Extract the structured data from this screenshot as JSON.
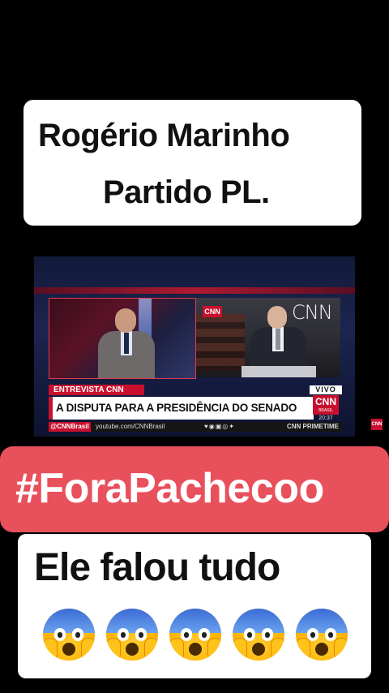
{
  "caption_top": {
    "line1": "Rogério Marinho",
    "line2": "Partido PL."
  },
  "video": {
    "wall_logo": "CNN",
    "small_logo": "CNN",
    "lower_third": {
      "tag": "ENTREVISTA CNN",
      "headline": "A DISPUTA PARA A PRESIDÊNCIA DO SENADO",
      "live": "VIVO",
      "logo": "CNN",
      "logo_sub": "BRASIL",
      "time": "20:37"
    },
    "ticker": {
      "brand": "@CNNBrasil",
      "url": "youtube.com/CNNBrasil",
      "social": "♥◉▣◎✦",
      "program": "CNN PRIMETIME"
    },
    "watermark": "CNN"
  },
  "hashtag": "#ForaPachecoo",
  "caption_bottom": {
    "text": "Ele falou tudo",
    "emoji_icons": [
      "face-screaming-in-fear",
      "face-screaming-in-fear",
      "face-screaming-in-fear",
      "face-screaming-in-fear",
      "face-screaming-in-fear"
    ]
  },
  "colors": {
    "hashtag_bg": "#e8505c",
    "cnn_red": "#c8102e"
  }
}
